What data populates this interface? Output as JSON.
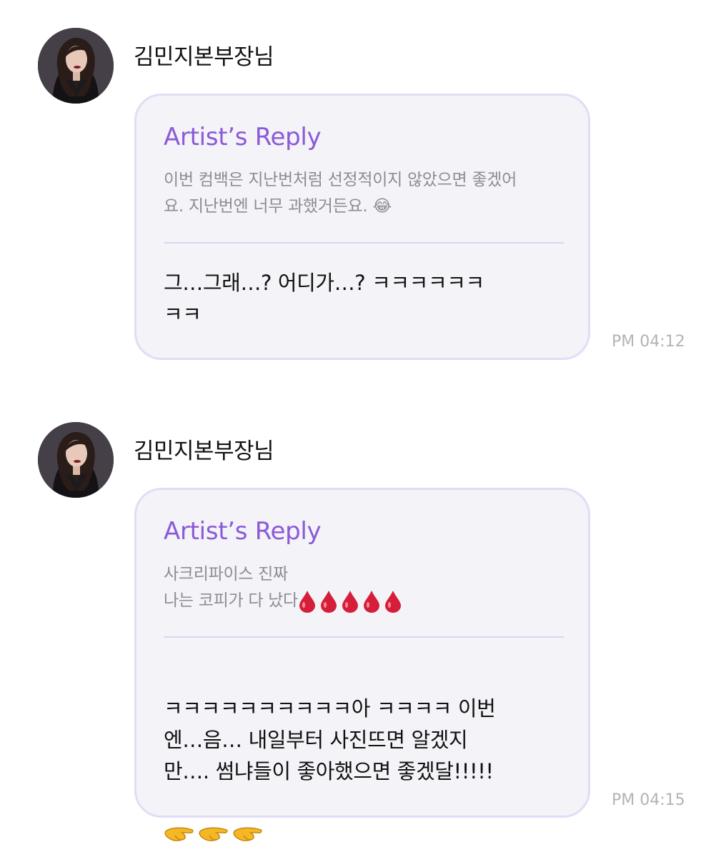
{
  "messages": [
    {
      "sender": "김민지본부장님",
      "reply_label": "Artist’s Reply",
      "quoted_text": "이번 컴백은 지난번처럼 선정적이지 않았으면 좋겠어\n요. 지난번엔 너무 과했거든요. 😂",
      "reply_text": "그…그래…? 어디가…? ㅋㅋㅋㅋㅋㅋ\nㅋㅋ",
      "time": "PM 04:12"
    },
    {
      "sender": "김민지본부장님",
      "reply_label": "Artist’s Reply",
      "quoted_text_line1": "사크리파이스 진짜",
      "quoted_text_line2": "나는 코피가 다 났다",
      "quoted_emoji": "drop-of-blood x5",
      "reply_text": "ㅋㅋㅋㅋㅋㅋㅋㅋㅋㅋ아 ㅋㅋㅋㅋ 이번\n엔…음… 내일부터 사진뜨면 알겠지\n만…. 썸냐들이 좋아했으면 좋겠달!!!!!",
      "reply_emoji": "pinching-hand x3",
      "time": "PM 04:15"
    }
  ],
  "colors": {
    "accent": "#8b5ad8",
    "bubble_bg": "#f3f3f8",
    "bubble_border": "#e3dcf6",
    "muted_text": "#8c8c92",
    "time_text": "#b3b3b8"
  }
}
